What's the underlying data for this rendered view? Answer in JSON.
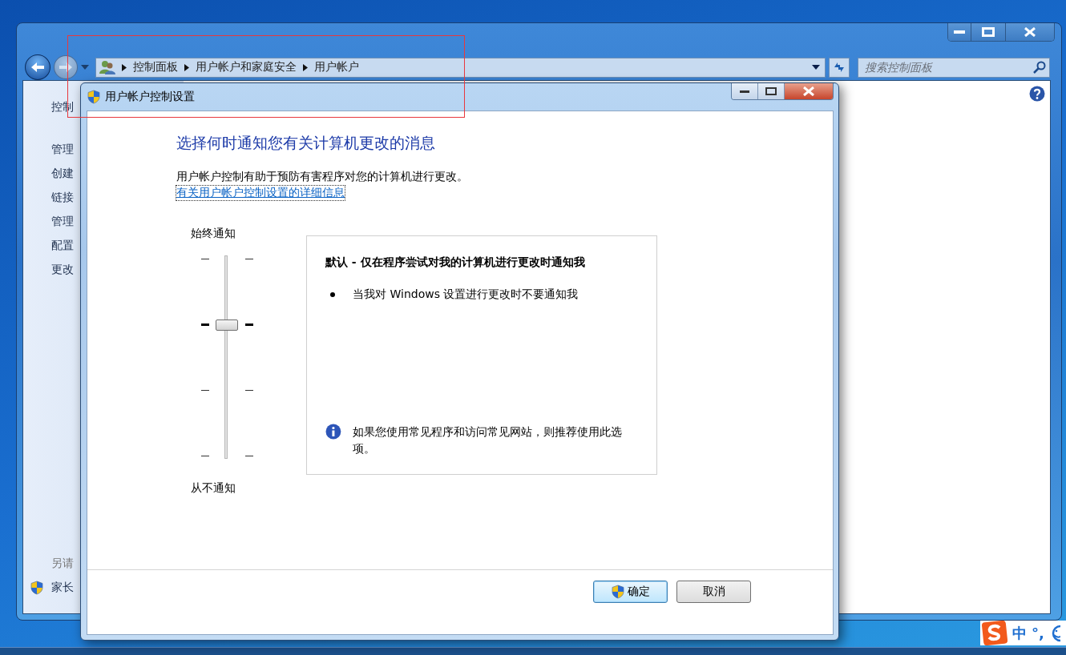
{
  "explorer": {
    "address_bar": {
      "crumbs": [
        "控制面板",
        "用户帐户和家庭安全",
        "用户帐户"
      ]
    },
    "search": {
      "placeholder": "搜索控制面板"
    },
    "sidebar": {
      "items": [
        "控制",
        "管理",
        "创建",
        "链接",
        "管理",
        "配置",
        "更改"
      ],
      "see_also_heading": "另请",
      "see_also": [
        "家长"
      ]
    }
  },
  "dialog": {
    "title": "用户帐户控制设置",
    "heading": "选择何时通知您有关计算机更改的消息",
    "description": "用户帐户控制有助于预防有害程序对您的计算机进行更改。",
    "link": "有关用户帐户控制设置的详细信息",
    "slider": {
      "top_label": "始终通知",
      "bottom_label": "从不通知",
      "level": 0.667
    },
    "info_panel": {
      "title": "默认 - 仅在程序尝试对我的计算机进行更改时通知我",
      "bullets": [
        "当我对 Windows 设置进行更改时不要通知我"
      ],
      "note": "如果您使用常见程序和访问常见网站，则推荐使用此选项。"
    },
    "buttons": [
      {
        "label": "确定",
        "kind": "shield"
      },
      {
        "label": "取消",
        "kind": "plain"
      }
    ]
  },
  "ime": {
    "mode": "中",
    "punctuation": "°,"
  },
  "highlight_frame": true
}
